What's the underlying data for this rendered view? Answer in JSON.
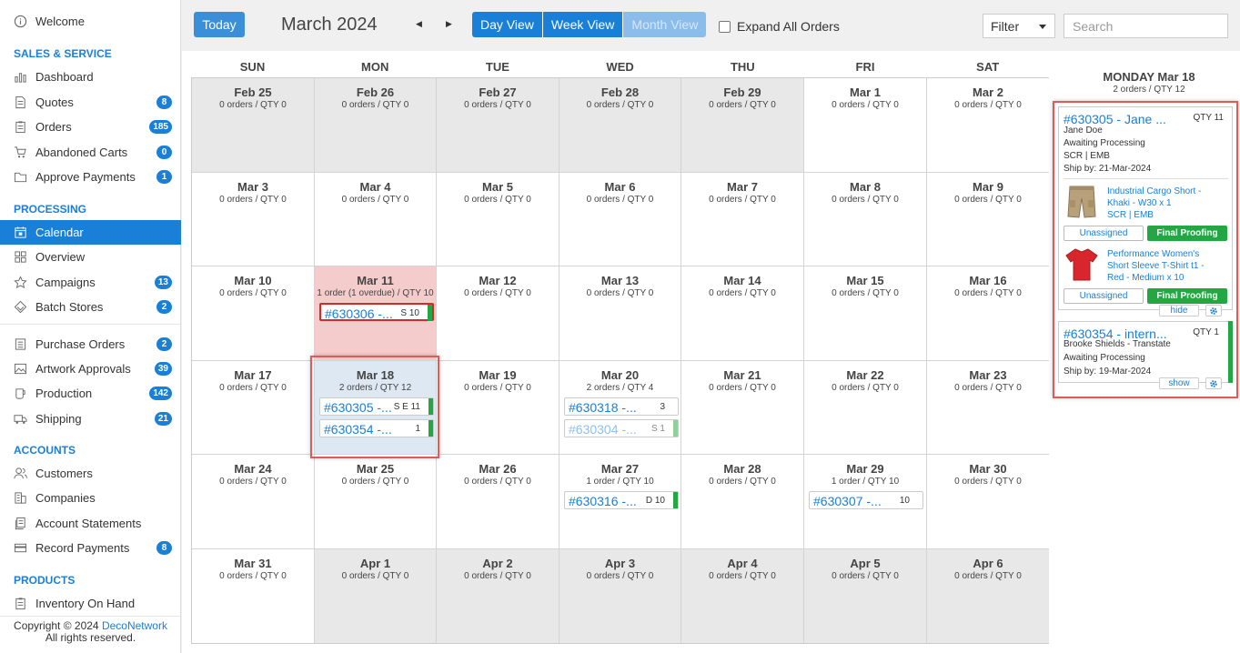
{
  "sidebar": {
    "welcome": "Welcome",
    "sections": [
      "SALES & SERVICE",
      "PROCESSING",
      "ACCOUNTS",
      "PRODUCTS"
    ],
    "sales": [
      {
        "label": "Dashboard",
        "icon": "bar-chart-icon"
      },
      {
        "label": "Quotes",
        "icon": "document-icon",
        "badge": "8"
      },
      {
        "label": "Orders",
        "icon": "clipboard-icon",
        "badge": "185"
      },
      {
        "label": "Abandoned Carts",
        "icon": "cart-icon",
        "badge": "0"
      },
      {
        "label": "Approve Payments",
        "icon": "folder-icon",
        "badge": "1"
      }
    ],
    "processing": [
      {
        "label": "Calendar",
        "icon": "calendar-icon",
        "active": true
      },
      {
        "label": "Overview",
        "icon": "grid-icon"
      },
      {
        "label": "Campaigns",
        "icon": "star-icon",
        "badge": "13"
      },
      {
        "label": "Batch Stores",
        "icon": "diamond-icon",
        "badge": "2"
      },
      {
        "label": "Purchase Orders",
        "icon": "list-icon",
        "badge": "2"
      },
      {
        "label": "Artwork Approvals",
        "icon": "image-icon",
        "badge": "39"
      },
      {
        "label": "Production",
        "icon": "cup-icon",
        "badge": "142"
      },
      {
        "label": "Shipping",
        "icon": "truck-icon",
        "badge": "21"
      }
    ],
    "accounts": [
      {
        "label": "Customers",
        "icon": "users-icon"
      },
      {
        "label": "Companies",
        "icon": "building-icon"
      },
      {
        "label": "Account Statements",
        "icon": "statement-icon"
      },
      {
        "label": "Record Payments",
        "icon": "card-icon",
        "badge": "8"
      }
    ],
    "products": [
      {
        "label": "Inventory On Hand",
        "icon": "inventory-icon"
      }
    ],
    "copyright_prefix": "Copyright © 2024 ",
    "copyright_link": "DecoNetwork",
    "copyright_suffix": "All rights reserved."
  },
  "toolbar": {
    "today": "Today",
    "month": "March 2024",
    "prev": "◀",
    "next": "▶",
    "views": [
      "Day View",
      "Week View",
      "Month View"
    ],
    "expand_all": "Expand All Orders",
    "filter": "Filter",
    "search_placeholder": "Search"
  },
  "calendar": {
    "days": [
      "SUN",
      "MON",
      "TUE",
      "WED",
      "THU",
      "FRI",
      "SAT"
    ],
    "weeks": [
      [
        {
          "d": "Feb 25",
          "s": "0 orders / QTY 0",
          "other": true
        },
        {
          "d": "Feb 26",
          "s": "0 orders / QTY 0",
          "other": true
        },
        {
          "d": "Feb 27",
          "s": "0 orders / QTY 0",
          "other": true
        },
        {
          "d": "Feb 28",
          "s": "0 orders / QTY 0",
          "other": true
        },
        {
          "d": "Feb 29",
          "s": "0 orders / QTY 0",
          "other": true
        },
        {
          "d": "Mar 1",
          "s": "0 orders / QTY 0"
        },
        {
          "d": "Mar 2",
          "s": "0 orders / QTY 0"
        }
      ],
      [
        {
          "d": "Mar 3",
          "s": "0 orders / QTY 0"
        },
        {
          "d": "Mar 4",
          "s": "0 orders / QTY 0"
        },
        {
          "d": "Mar 5",
          "s": "0 orders / QTY 0"
        },
        {
          "d": "Mar 6",
          "s": "0 orders / QTY 0"
        },
        {
          "d": "Mar 7",
          "s": "0 orders / QTY 0"
        },
        {
          "d": "Mar 8",
          "s": "0 orders / QTY 0"
        },
        {
          "d": "Mar 9",
          "s": "0 orders / QTY 0"
        }
      ],
      [
        {
          "d": "Mar 10",
          "s": "0 orders / QTY 0"
        },
        {
          "d": "Mar 11",
          "s": "1 order (1 overdue) / QTY 10",
          "overdue": true,
          "orders": [
            {
              "o": "#630306 -...",
              "q": "S 10",
              "red": true
            }
          ]
        },
        {
          "d": "Mar 12",
          "s": "0 orders / QTY 0"
        },
        {
          "d": "Mar 13",
          "s": "0 orders / QTY 0"
        },
        {
          "d": "Mar 14",
          "s": "0 orders / QTY 0"
        },
        {
          "d": "Mar 15",
          "s": "0 orders / QTY 0"
        },
        {
          "d": "Mar 16",
          "s": "0 orders / QTY 0"
        }
      ],
      [
        {
          "d": "Mar 17",
          "s": "0 orders / QTY 0"
        },
        {
          "d": "Mar 18",
          "s": "2 orders / QTY 12",
          "sel": true,
          "orders": [
            {
              "o": "#630305 -...",
              "q": "S E 11"
            },
            {
              "o": "#630354 -...",
              "q": "1"
            }
          ]
        },
        {
          "d": "Mar 19",
          "s": "0 orders / QTY 0"
        },
        {
          "d": "Mar 20",
          "s": "2 orders / QTY 4",
          "orders": [
            {
              "o": "#630318 -...",
              "q": "3",
              "nobar": true
            },
            {
              "o": "#630304 -...",
              "q": "S 1",
              "faded": true
            }
          ]
        },
        {
          "d": "Mar 21",
          "s": "0 orders / QTY 0"
        },
        {
          "d": "Mar 22",
          "s": "0 orders / QTY 0"
        },
        {
          "d": "Mar 23",
          "s": "0 orders / QTY 0"
        }
      ],
      [
        {
          "d": "Mar 24",
          "s": "0 orders / QTY 0"
        },
        {
          "d": "Mar 25",
          "s": "0 orders / QTY 0"
        },
        {
          "d": "Mar 26",
          "s": "0 orders / QTY 0"
        },
        {
          "d": "Mar 27",
          "s": "1 order / QTY 10",
          "orders": [
            {
              "o": "#630316 -...",
              "q": "D 10"
            }
          ]
        },
        {
          "d": "Mar 28",
          "s": "0 orders / QTY 0"
        },
        {
          "d": "Mar 29",
          "s": "1 order / QTY 10",
          "orders": [
            {
              "o": "#630307 -...",
              "q": "10",
              "nobar": true
            }
          ]
        },
        {
          "d": "Mar 30",
          "s": "0 orders / QTY 0"
        }
      ],
      [
        {
          "d": "Mar 31",
          "s": "0 orders / QTY 0"
        },
        {
          "d": "Apr 1",
          "s": "0 orders / QTY 0",
          "other": true
        },
        {
          "d": "Apr 2",
          "s": "0 orders / QTY 0",
          "other": true
        },
        {
          "d": "Apr 3",
          "s": "0 orders / QTY 0",
          "other": true
        },
        {
          "d": "Apr 4",
          "s": "0 orders / QTY 0",
          "other": true
        },
        {
          "d": "Apr 5",
          "s": "0 orders / QTY 0",
          "other": true
        },
        {
          "d": "Apr 6",
          "s": "0 orders / QTY 0",
          "other": true
        }
      ]
    ]
  },
  "detail": {
    "title": "MONDAY Mar 18",
    "subtitle": "2 orders / QTY 12",
    "card1": {
      "order": "#630305 - Jane ...",
      "qty": "QTY 11",
      "customer": "Jane Doe",
      "status": "Awaiting Processing",
      "process": "SCR | EMB",
      "ship": "Ship by: 21-Mar-2024",
      "products": [
        {
          "lines": [
            "Industrial Cargo Short -",
            "Khaki - W30 x 1",
            "SCR | EMB"
          ],
          "icon": "shorts-icon"
        },
        {
          "lines": [
            "Performance Women's",
            "Short Sleeve T-Shirt t1 -",
            "Red - Medium x 10"
          ],
          "icon": "tshirt-icon"
        }
      ],
      "unassigned": "Unassigned",
      "final_proofing": "Final Proofing",
      "hide": "hide"
    },
    "card2": {
      "order": "#630354 - intern...",
      "qty": "QTY 1",
      "customer": "Brooke Shields - Transtate",
      "status": "Awaiting Processing",
      "ship": "Ship by: 19-Mar-2024",
      "show": "show"
    },
    "colors": {
      "accent": "#1a7fd6",
      "success": "#22a744",
      "overdue": "#f5cccc",
      "highlight": "#e05a5a"
    }
  }
}
